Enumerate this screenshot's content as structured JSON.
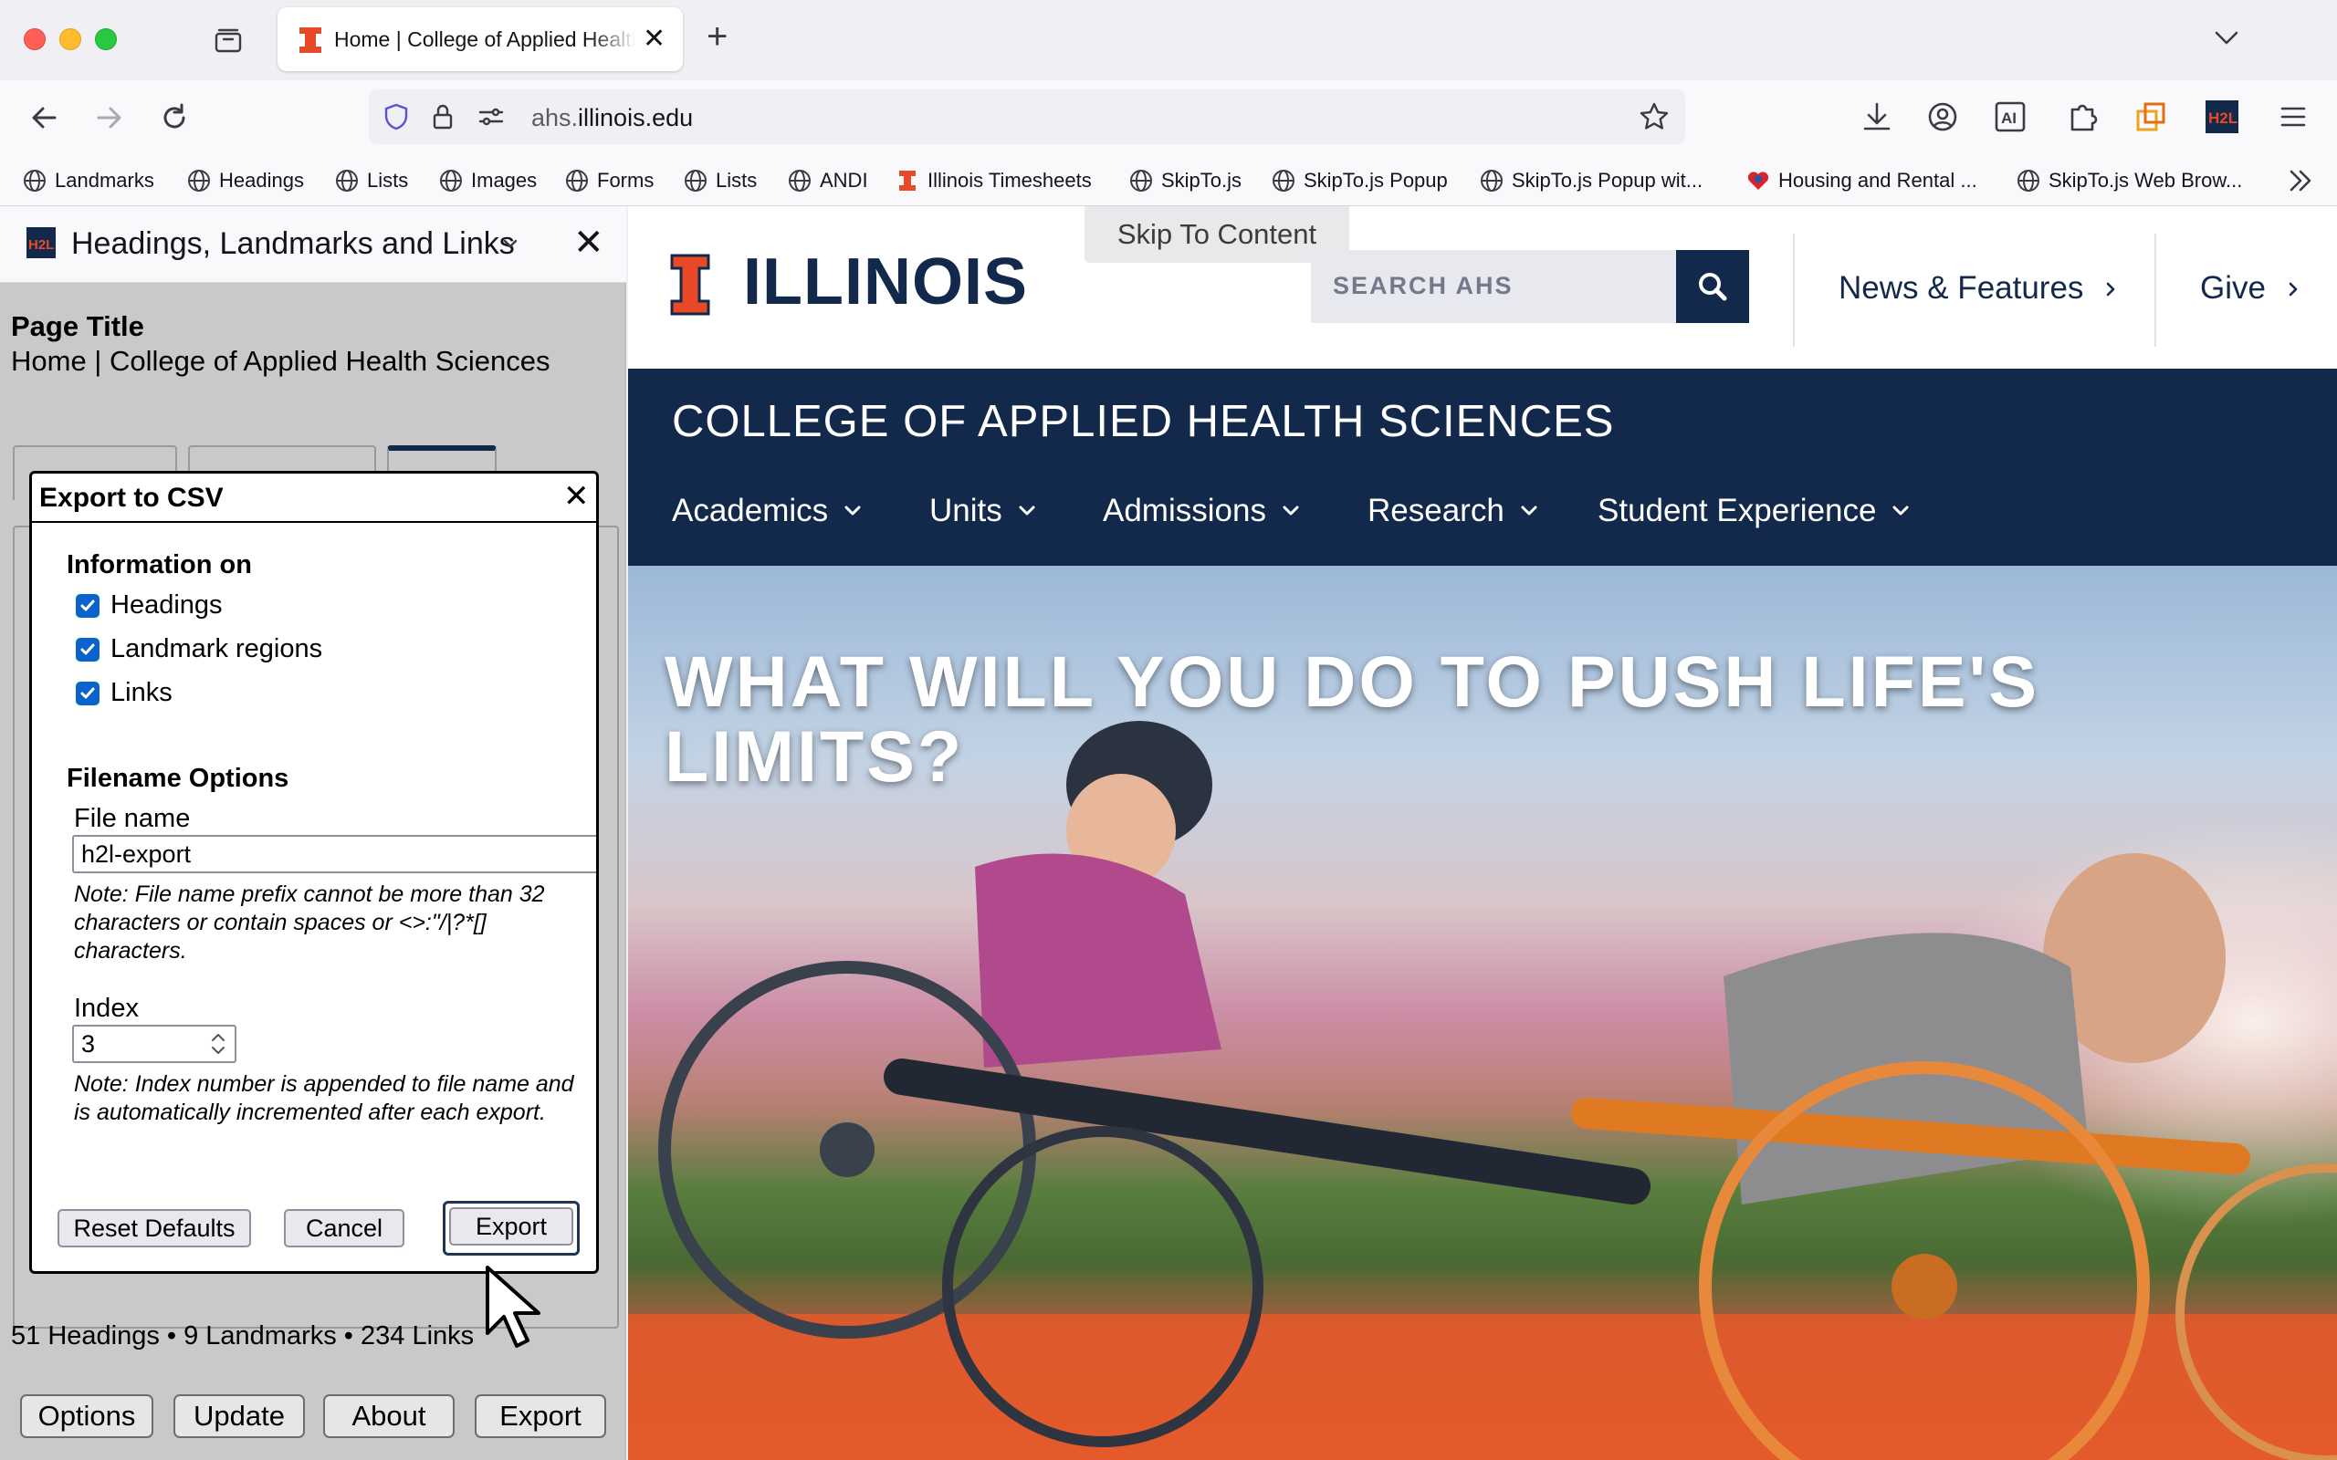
{
  "browser": {
    "active_tab_title": "Home | College of Applied Health Sciences",
    "url_host_prefix": "ahs.",
    "url_host_domain": "illinois.edu",
    "bookmarks": [
      "Landmarks",
      "Headings",
      "Lists",
      "Images",
      "Forms",
      "Lists",
      "ANDI",
      "Illinois Timesheets",
      "SkipTo.js",
      "SkipTo.js Popup",
      "SkipTo.js Popup wit...",
      "Housing and Rental ...",
      "SkipTo.js Web Brow..."
    ]
  },
  "sidebar": {
    "title": "Headings, Landmarks and Links",
    "page_title_label": "Page Title",
    "page_title_value": "Home | College of Applied Health Sciences",
    "summary": "51 Headings • 9 Landmarks • 234 Links",
    "buttons": {
      "options": "Options",
      "update": "Update",
      "about": "About",
      "export": "Export"
    }
  },
  "dialog": {
    "title": "Export to CSV",
    "info_label": "Information on",
    "checkboxes": [
      {
        "label": "Headings",
        "checked": true
      },
      {
        "label": "Landmark regions",
        "checked": true
      },
      {
        "label": "Links",
        "checked": true
      }
    ],
    "filename_options_label": "Filename Options",
    "file_name_label": "File name",
    "file_name_value": "h2l-export",
    "file_name_note": "Note: File name prefix cannot be more than 32 characters or contain spaces or <>:\"/|?*[] characters.",
    "index_label": "Index",
    "index_value": "3",
    "index_note": "Note: Index number is appended to file name and is automatically incremented after each export.",
    "buttons": {
      "reset": "Reset Defaults",
      "cancel": "Cancel",
      "export": "Export"
    }
  },
  "website": {
    "skip_link": "Skip To Content",
    "logo_text": "ILLINOIS",
    "search_placeholder": "SEARCH AHS",
    "utility_links": [
      "News & Features",
      "Give"
    ],
    "college_name": "COLLEGE OF APPLIED HEALTH SCIENCES",
    "main_nav": [
      "Academics",
      "Units",
      "Admissions",
      "Research",
      "Student Experience"
    ],
    "hero_headline": "WHAT WILL YOU DO TO PUSH LIFE'S LIMITS?"
  },
  "colors": {
    "illinois_blue": "#13294b",
    "illinois_orange": "#e84a27",
    "checkbox_blue": "#0b63ce"
  }
}
